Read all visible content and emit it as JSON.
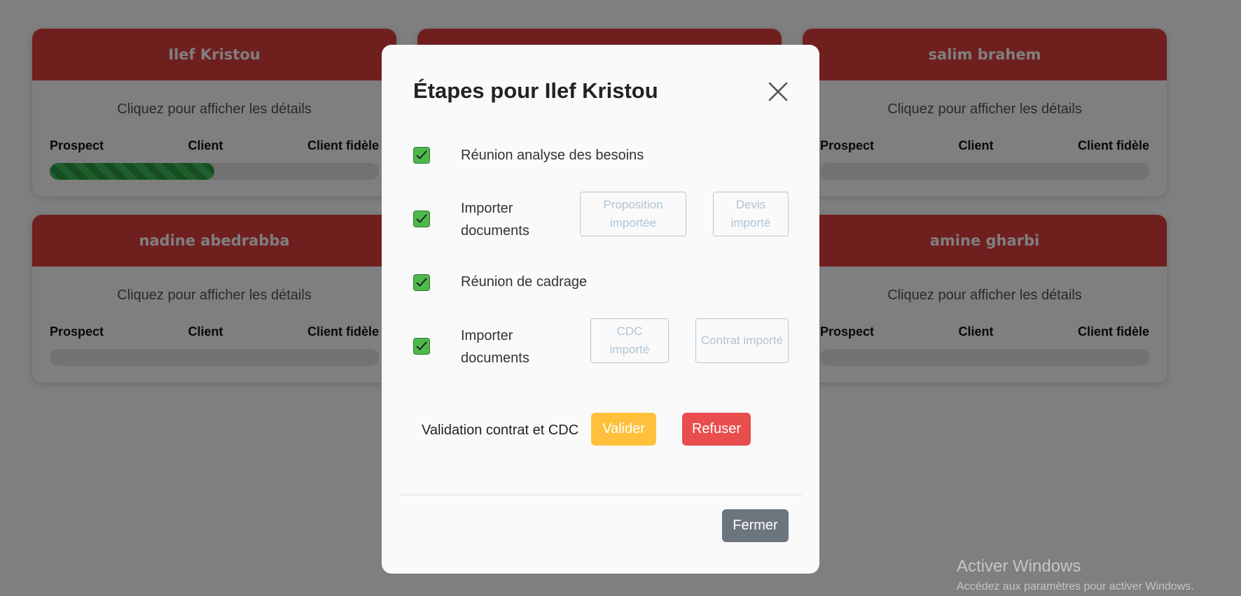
{
  "cards": [
    {
      "name": "Ilef Kristou",
      "hint": "Cliquez pour afficher les détails",
      "stages": [
        "Prospect",
        "Client",
        "Client fidèle"
      ],
      "progress_pct": 50
    },
    {
      "name": "",
      "hint": "",
      "stages": [
        "",
        "",
        ""
      ],
      "progress_pct": 0
    },
    {
      "name": "salim brahem",
      "hint": "Cliquez pour afficher les détails",
      "stages": [
        "Prospect",
        "Client",
        "Client fidèle"
      ],
      "progress_pct": 0
    },
    {
      "name": "nadine abedrabba",
      "hint": "Cliquez pour afficher les détails",
      "stages": [
        "Prospect",
        "Client",
        "Client fidèle"
      ],
      "progress_pct": 0
    },
    {
      "name": "amine gharbi",
      "hint": "Cliquez pour afficher les détails",
      "stages": [
        "Prospect",
        "Client",
        "Client fidèle"
      ],
      "progress_pct": 0
    }
  ],
  "modal": {
    "title": "Étapes pour Ilef Kristou",
    "steps": [
      {
        "label": "Réunion analyse des besoins",
        "checked": true
      },
      {
        "label": "Importer documents",
        "checked": true,
        "documents": [
          "Proposition importée",
          "Devis importé"
        ]
      },
      {
        "label": "Réunion de cadrage",
        "checked": true
      },
      {
        "label": "Importer documents",
        "checked": true,
        "documents": [
          "CDC importé",
          "Contrat importé"
        ]
      }
    ],
    "validation": {
      "label": "Validation contrat et CDC",
      "accept": "Valider",
      "reject": "Refuser"
    },
    "close_label": "Fermer"
  },
  "watermark": {
    "title": "Activer Windows",
    "subtitle": "Accédez aux paramètres pour activer Windows."
  },
  "colors": {
    "card_header": "#e13f3f",
    "progress": "#3fbf58",
    "valider": "#ffc13b",
    "refuser": "#e84e4e",
    "fermer": "#6c757d",
    "check": "#4cb84c"
  }
}
